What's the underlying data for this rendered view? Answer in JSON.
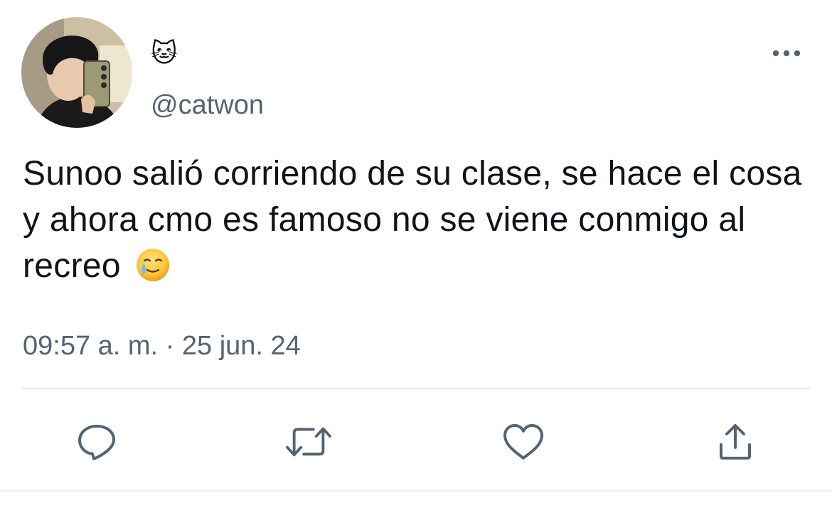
{
  "user": {
    "display_name": "🐱",
    "handle": "@catwon"
  },
  "tweet": {
    "text": "Sunoo salió corriendo de su clase, se hace el cosa y ahora cmo es famoso no se viene conmigo al recreo",
    "trailing_emoji": "🥲",
    "timestamp": "09:57 a. m. · 25 jun. 24"
  },
  "icons": {
    "more": "more-options-icon",
    "reply": "reply-icon",
    "retweet": "retweet-icon",
    "like": "like-icon",
    "share": "share-icon"
  },
  "colors": {
    "text": "#0f1419",
    "secondary": "#536471",
    "divider": "#e7ebee"
  }
}
